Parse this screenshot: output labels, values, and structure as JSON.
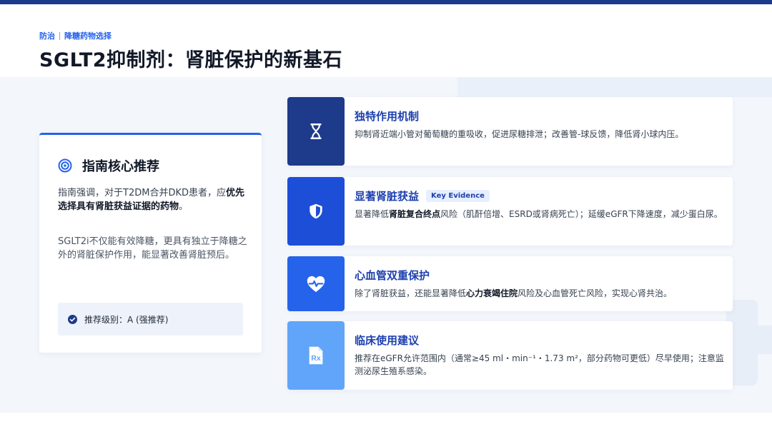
{
  "header": {
    "breadcrumb": [
      "防治",
      "降糖药物选择"
    ],
    "title": "SGLT2抑制剂：肾脏保护的新基石"
  },
  "guideline": {
    "title": "指南核心推荐",
    "para1_prefix": "指南强调，对于T2DM合并DKD患者，应",
    "para1_bold": "优先选择具有肾脏获益证据的药物",
    "para1_suffix": "。",
    "para2": "SGLT2i不仅能有效降糖，更具有独立于降糖之外的肾脏保护作用，能显著改善肾脏预后。",
    "grade": "推荐级别：A (强推荐)"
  },
  "cards": [
    {
      "title": "独特作用机制",
      "icon": "hourglass-icon",
      "desc": "抑制肾近端小管对葡萄糖的重吸收，促进尿糖排泄；改善管-球反馈，降低肾小球内压。"
    },
    {
      "title": "显著肾脏获益",
      "badge": "Key Evidence",
      "icon": "shield-icon",
      "desc_prefix": "显著降低",
      "desc_bold": "肾脏复合终点",
      "desc_suffix": "风险（肌酐倍增、ESRD或肾病死亡）；延缓eGFR下降速度，减少蛋白尿。"
    },
    {
      "title": "心血管双重保护",
      "icon": "heart-pulse-icon",
      "desc_prefix": "除了肾脏获益，还能显著降低",
      "desc_bold": "心力衰竭住院",
      "desc_suffix": "风险及心血管死亡风险，实现心肾共治。"
    },
    {
      "title": "临床使用建议",
      "icon": "prescription-icon",
      "desc": "推荐在eGFR允许范围内（通常≥45 ml・min⁻¹・1.73 m²，部分药物可更低）尽早使用；注意监测泌尿生殖系感染。"
    }
  ],
  "colors": {
    "accent": "#2563eb",
    "navy": "#1e3a8a",
    "icon_bg": [
      "#1e3a8a",
      "#1d4ed8",
      "#2563eb",
      "#60a5fa"
    ]
  }
}
